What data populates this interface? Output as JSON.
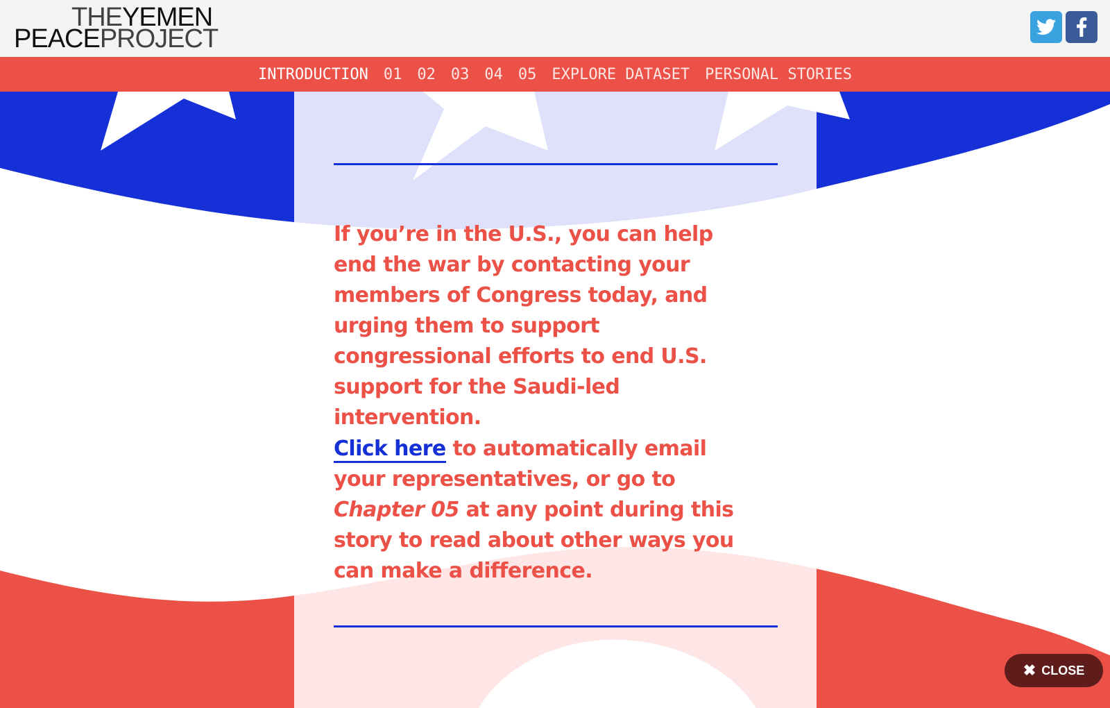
{
  "header": {
    "logo": {
      "row1_thin": "THE",
      "row1_bold": "YEMEN",
      "row2_bold": "PEACE",
      "row2_thin": "PROJECT"
    },
    "social": {
      "twitter_icon": "twitter-icon",
      "facebook_icon": "facebook-icon",
      "twitter_color": "#3aa3df",
      "facebook_color": "#3a5b98"
    }
  },
  "nav": {
    "items": [
      {
        "label": "INTRODUCTION"
      },
      {
        "label": "01"
      },
      {
        "label": "02"
      },
      {
        "label": "03"
      },
      {
        "label": "04"
      },
      {
        "label": "05"
      },
      {
        "label": "EXPLORE DATASET"
      },
      {
        "label": "PERSONAL STORIES"
      }
    ],
    "active": "INTRODUCTION",
    "color": "#ec5148"
  },
  "main": {
    "paragraph1": "If you’re in the U.S., you can help end the war by contacting your members of Congress today, and urging them to support congressional efforts to end U.S. support for the Saudi-led intervention.",
    "paragraph2": {
      "link": "Click here",
      "text_a": " to automatically email your representatives, or go to ",
      "emphasis": "Chapter 05",
      "text_b": " at any point during this story to read about other ways you can make a difference."
    }
  },
  "close_button": {
    "label": "CLOSE",
    "icon": "close-icon"
  },
  "colors": {
    "red": "#ec5148",
    "blue": "#1530d6",
    "dark_red": "#5e1c1a"
  }
}
